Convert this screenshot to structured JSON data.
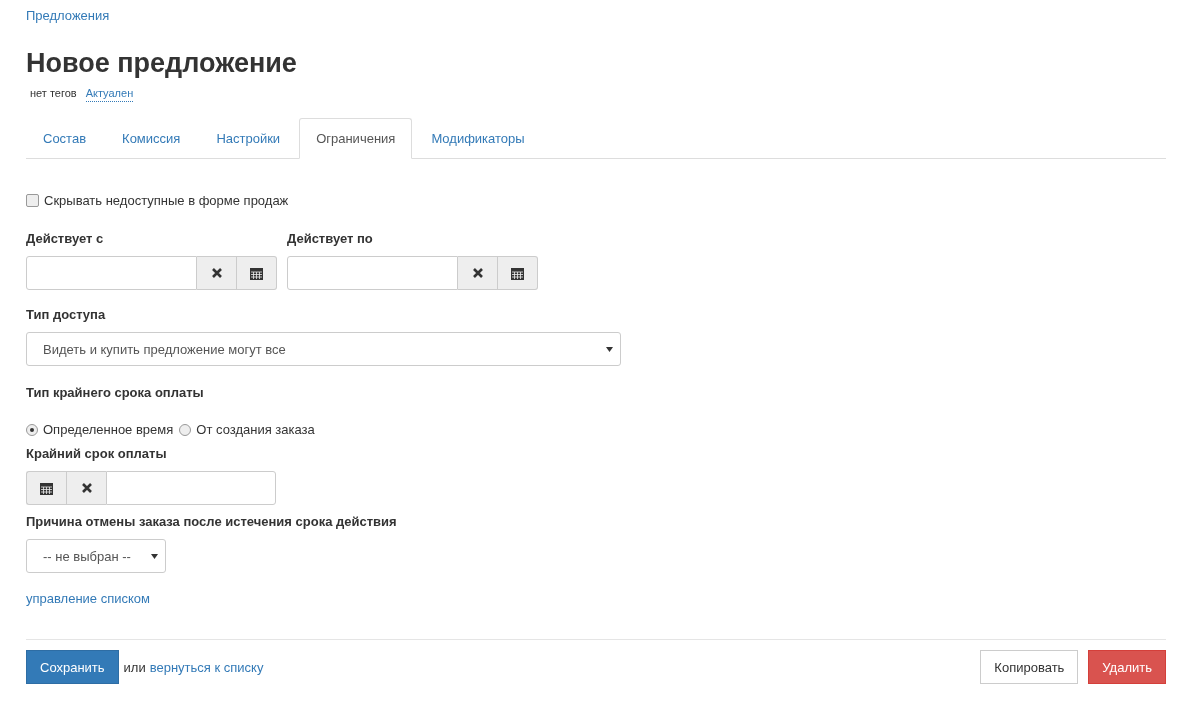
{
  "breadcrumb": "Предложения",
  "title": "Новое предложение",
  "tags_label": "нет тегов",
  "status_link": "Актуален",
  "tabs": [
    {
      "label": "Состав",
      "selected": false
    },
    {
      "label": "Комиссия",
      "selected": false
    },
    {
      "label": "Настройки",
      "selected": false
    },
    {
      "label": "Ограничения",
      "selected": true
    },
    {
      "label": "Модификаторы",
      "selected": false
    }
  ],
  "hide_unavailable": {
    "label": "Скрывать недоступные в форме продаж",
    "checked": false
  },
  "date_fields": [
    {
      "label": "Действует с",
      "buttons": [
        {
          "kind": "clear"
        },
        {
          "kind": "calendar"
        }
      ]
    },
    {
      "label": "Действует по",
      "buttons": [
        {
          "kind": "clear"
        },
        {
          "kind": "calendar"
        }
      ]
    }
  ],
  "access_type": {
    "label": "Тип доступа",
    "value": "Видеть и купить предложение могут все"
  },
  "deadline_type": {
    "label": "Тип крайнего срока оплаты",
    "options": [
      {
        "label": "Определенное время",
        "selected": true
      },
      {
        "label": "От создания заказа",
        "selected": false
      }
    ]
  },
  "deadline": {
    "label": "Крайний срок оплаты",
    "buttons": [
      {
        "kind": "calendar"
      },
      {
        "kind": "clear"
      }
    ]
  },
  "cancel_reason": {
    "label": "Причина отмены заказа после истечения срока действия",
    "value": "-- не выбран --",
    "manage_link": "управление списком"
  },
  "footer": {
    "save": "Сохранить",
    "or": "или",
    "back_link": "вернуться к списку",
    "copy": "Копировать",
    "delete": "Удалить"
  }
}
